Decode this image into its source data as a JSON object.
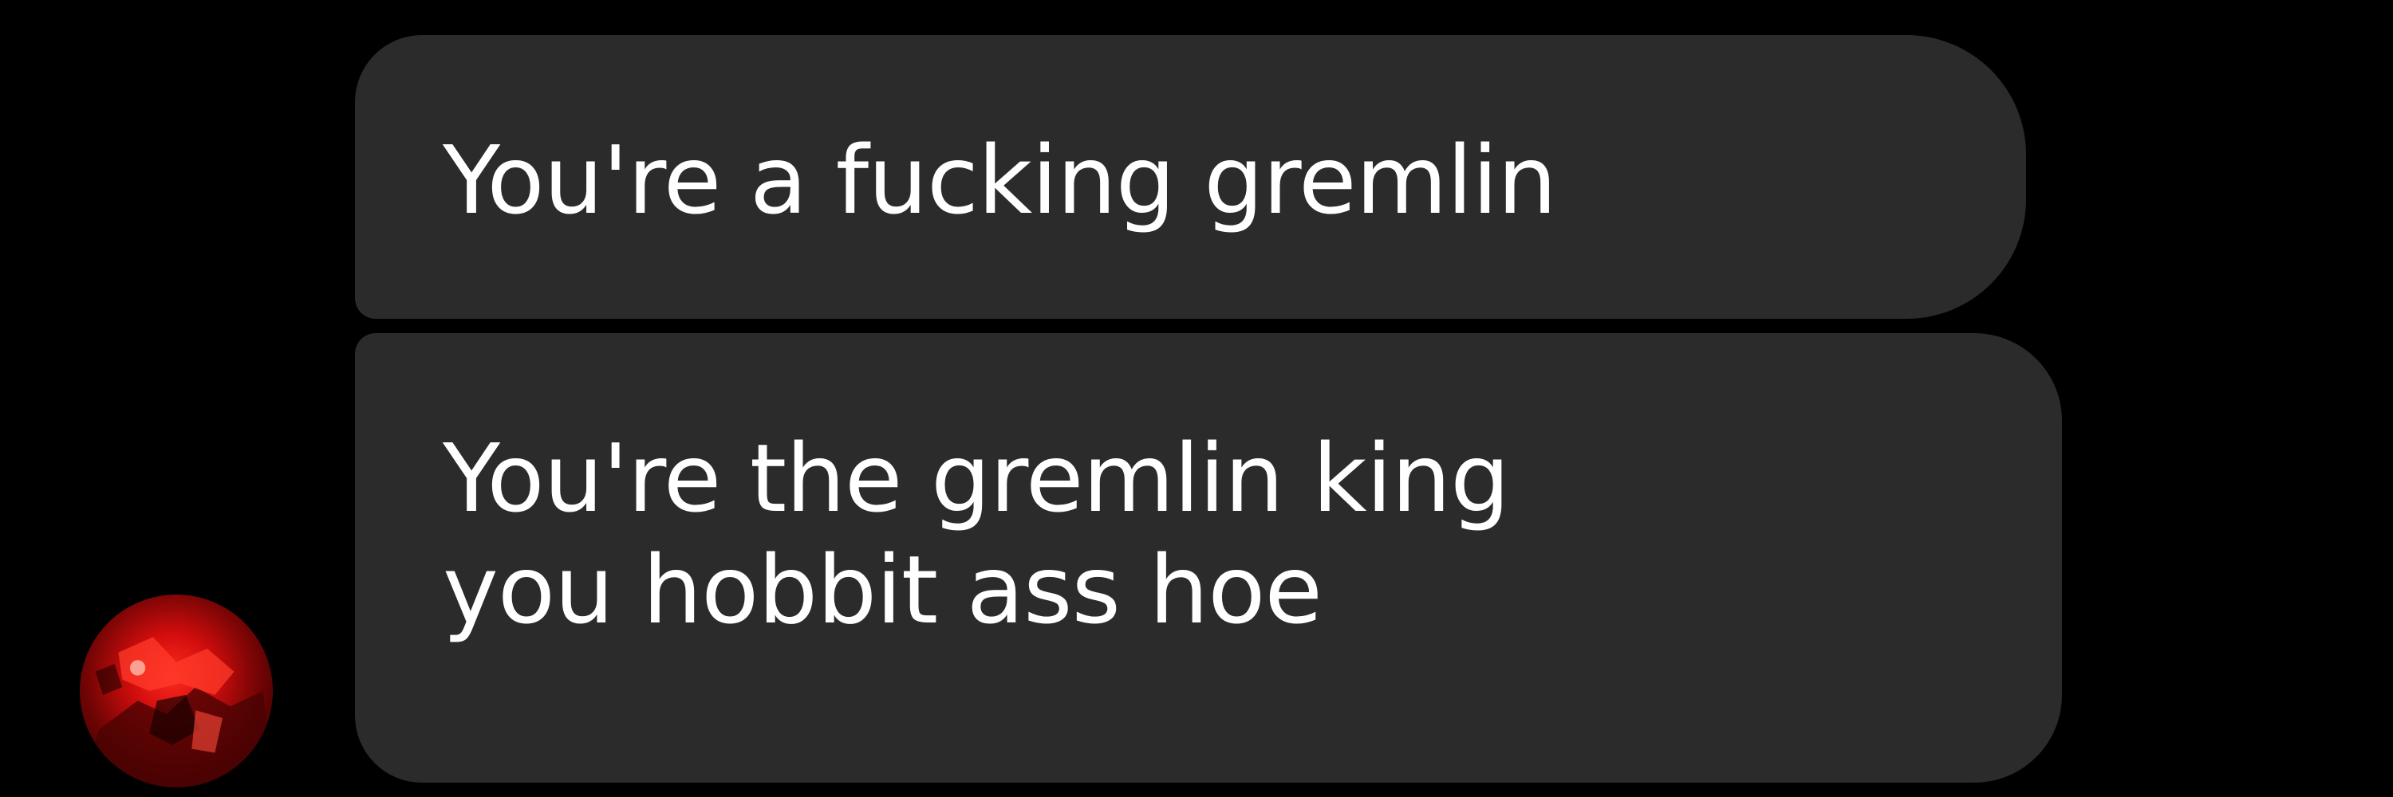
{
  "conversation": {
    "messages": [
      {
        "lines": [
          "You're a fucking gremlin"
        ]
      },
      {
        "lines": [
          "You're the gremlin king",
          "you hobbit ass hoe"
        ]
      }
    ]
  },
  "theme": {
    "background": "#000000",
    "bubble_color": "#2b2b2b",
    "text_color": "#ffffff",
    "avatar_accent": "#e01010"
  },
  "avatar": {
    "icon": "profile-photo-icon"
  }
}
